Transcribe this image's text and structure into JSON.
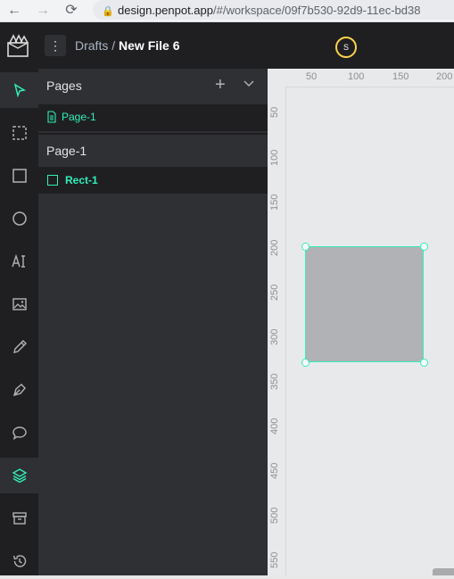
{
  "browser": {
    "url_host": "design.penpot.app",
    "url_path": "/#/workspace/09f7b530-92d9-11ec-bd38"
  },
  "header": {
    "breadcrumb_root": "Drafts",
    "breadcrumb_sep": " / ",
    "file_name": "New File 6",
    "avatar_letter": "S"
  },
  "sidebar": {
    "pages_title": "Pages",
    "pages": [
      {
        "label": "Page-1"
      }
    ],
    "layers_title": "Page-1",
    "layers": [
      {
        "label": "Rect-1"
      }
    ]
  },
  "rulers": {
    "h_ticks": [
      "50",
      "100",
      "150",
      "200"
    ],
    "v_ticks": [
      "50",
      "100",
      "150",
      "200",
      "250",
      "300",
      "350",
      "400",
      "450",
      "500",
      "550"
    ]
  },
  "colors": {
    "accent": "#31efb8",
    "panel": "#2e3033",
    "dark": "#1f1f21",
    "canvas": "#e8e9ea",
    "rect_fill": "#b1b2b5"
  }
}
